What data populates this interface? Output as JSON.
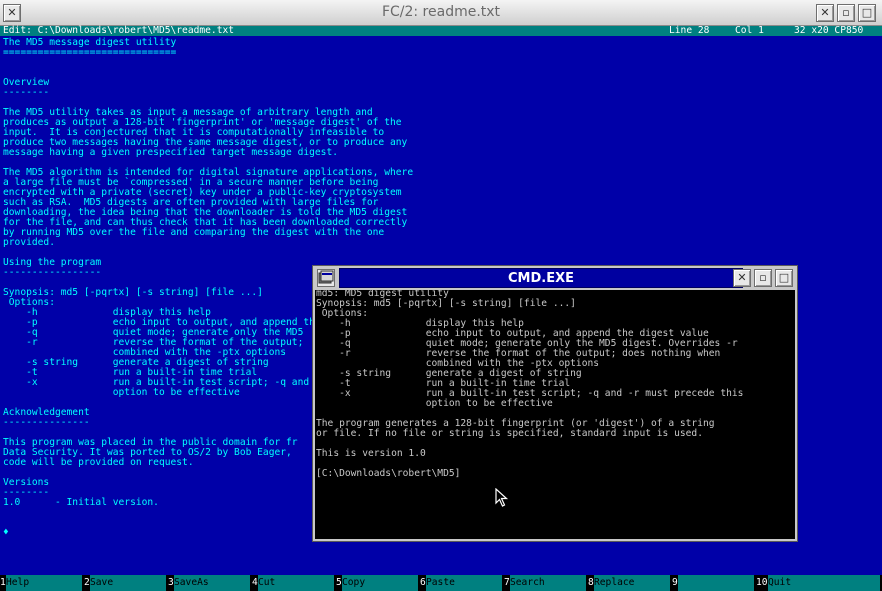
{
  "fc": {
    "title": "FC/2: readme.txt",
    "status": {
      "file": "Edit: C:\\Downloads\\robert\\MD5\\readme.txt",
      "line": "Line 28",
      "col": "Col 1",
      "info": "32 x20 CP850"
    },
    "lines": [
      "The MD5 message digest utility",
      "==============================",
      "",
      "",
      "Overview",
      "--------",
      "",
      "The MD5 utility takes as input a message of arbitrary length and",
      "produces as output a 128-bit 'fingerprint' or 'message digest' of the",
      "input.  It is conjectured that it is computationally infeasible to",
      "produce two messages having the same message digest, or to produce any",
      "message having a given prespecified target message digest.",
      "",
      "The MD5 algorithm is intended for digital signature applications, where",
      "a large file must be `compressed' in a secure manner before being",
      "encrypted with a private (secret) key under a public-key cryptosystem",
      "such as RSA.  MD5 digests are often provided with large files for",
      "downloading, the idea being that the downloader is told the MD5 digest",
      "for the file, and can thus check that it has been downloaded correctly",
      "by running MD5 over the file and comparing the digest with the one",
      "provided.",
      "",
      "Using the program",
      "-----------------",
      "",
      "Synopsis: md5 [-pqrtx] [-s string] [file ...]",
      " Options:",
      "    -h             display this help",
      "    -p             echo input to output, and append the",
      "    -q             quiet mode; generate only the MD5",
      "    -r             reverse the format of the output;",
      "                   combined with the -ptx options",
      "    -s string      generate a digest of string",
      "    -t             run a built-in time trial",
      "    -x             run a built-in test script; -q and",
      "                   option to be effective",
      "",
      "Acknowledgement",
      "---------------",
      "",
      "This program was placed in the public domain for fr",
      "Data Security. It was ported to OS/2 by Bob Eager,",
      "code will be provided on request.",
      "",
      "Versions",
      "--------",
      "1.0      - Initial version.",
      "",
      "",
      "♦"
    ],
    "fkeys": [
      {
        "num": "1",
        "label": "Help"
      },
      {
        "num": "2",
        "label": "Save"
      },
      {
        "num": "3",
        "label": "SaveAs"
      },
      {
        "num": "4",
        "label": "Cut"
      },
      {
        "num": "5",
        "label": "Copy"
      },
      {
        "num": "6",
        "label": "Paste"
      },
      {
        "num": "7",
        "label": "Search"
      },
      {
        "num": "8",
        "label": "Replace"
      },
      {
        "num": "9",
        "label": ""
      },
      {
        "num": "10",
        "label": "Quit"
      }
    ],
    "colors": {
      "editor_bg": "#0000a8",
      "editor_text": "#00ffff",
      "status_bg": "#008080"
    }
  },
  "cmd": {
    "title": "CMD.EXE",
    "lines": [
      "md5: MD5 digest utility",
      "Synopsis: md5 [-pqrtx] [-s string] [file ...]",
      " Options:",
      "    -h             display this help",
      "    -p             echo input to output, and append the digest value",
      "    -q             quiet mode; generate only the MD5 digest. Overrides -r",
      "    -r             reverse the format of the output; does nothing when",
      "                   combined with the -ptx options",
      "    -s string      generate a digest of string",
      "    -t             run a built-in time trial",
      "    -x             run a built-in test script; -q and -r must precede this",
      "                   option to be effective",
      "",
      "The program generates a 128-bit fingerprint (or 'digest') of a string",
      "or file. If no file or string is specified, standard input is used.",
      "",
      "This is version 1.0",
      "",
      "[C:\\Downloads\\robert\\MD5]"
    ]
  },
  "icons": {
    "close": "close-icon",
    "minimize": "minimize-icon",
    "maximize": "maximize-icon",
    "cursor": "mouse-pointer-icon"
  }
}
